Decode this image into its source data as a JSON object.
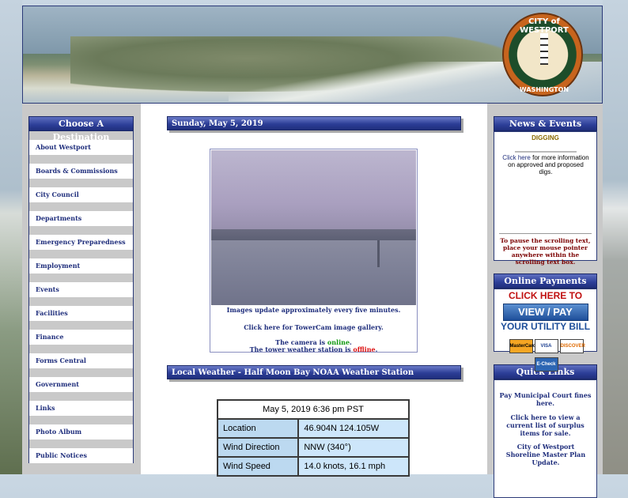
{
  "header": {
    "seal_top": "CITY of WESTPORT",
    "seal_bottom": "WASHINGTON"
  },
  "leftnav": {
    "title": "Choose A Destination",
    "items": [
      {
        "label": "About Westport"
      },
      {
        "label": "Boards & Commissions"
      },
      {
        "label": "City Council"
      },
      {
        "label": "Departments"
      },
      {
        "label": "Emergency Preparedness"
      },
      {
        "label": "Employment"
      },
      {
        "label": "Events"
      },
      {
        "label": "Facilities"
      },
      {
        "label": "Finance"
      },
      {
        "label": "Forms Central"
      },
      {
        "label": "Government"
      },
      {
        "label": "Links"
      },
      {
        "label": "Photo Album"
      },
      {
        "label": "Public Notices"
      }
    ]
  },
  "center": {
    "date_title": "Sunday, May 5, 2019",
    "cam_update": "Images update approximately every five minutes.",
    "cam_gallery": "Click here for TowerCam image gallery.",
    "camera_prefix": "The camera is ",
    "camera_status": "online",
    "station_prefix": "The tower weather station is ",
    "station_status": "offline",
    "weather_title": "Local Weather - Half Moon Bay NOAA Weather Station",
    "weather": {
      "timestamp": "May 5, 2019 6:36 pm PST",
      "rows": [
        {
          "label": "Location",
          "value": "46.904N 124.105W"
        },
        {
          "label": "Wind Direction",
          "value": "NNW (340°)"
        },
        {
          "label": "Wind Speed",
          "value": "14.0 knots, 16.1 mph"
        }
      ]
    }
  },
  "right": {
    "news_title": "News & Events",
    "news_heading": "DIGGING",
    "news_link": "Click here",
    "news_text": " for more information on approved and proposed digs.",
    "pause_note": "To pause the scrolling text, place your mouse pointer anywhere within the scrolling text box.",
    "payments_title": "Online Payments",
    "pay_click": "CLICK HERE TO",
    "pay_button": "VIEW / PAY",
    "pay_utility": "YOUR UTILITY BILL",
    "cards": [
      "MasterCard",
      "VISA",
      "DISCOVER",
      "E-Check"
    ],
    "quick_title": "Quick Links",
    "quick_links": [
      "Pay Municipal Court fines here.",
      "Click here to view a current list of surplus items for sale.",
      "City of Westport Shoreline Master Plan Update."
    ]
  },
  "colors": {
    "nav_blue": "#1f2e7c",
    "online": "#119911",
    "offline": "#dd1111"
  }
}
